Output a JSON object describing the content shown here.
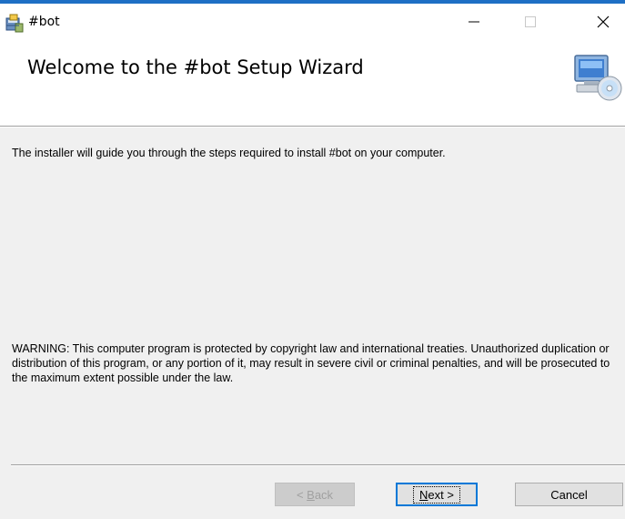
{
  "window": {
    "title": "#bot",
    "minimize_glyph": "—",
    "maximize_glyph": "☐",
    "close_glyph": "✕",
    "accent_color": "#1e6fc5"
  },
  "banner": {
    "title": "Welcome to the #bot Setup Wizard",
    "icon": "computer-cd-icon"
  },
  "body": {
    "intro": "The installer will guide you through the steps required to install #bot on your computer.",
    "warning": "WARNING: This computer program is protected by copyright law and international treaties. Unauthorized duplication or distribution of this program, or any portion of it, may result in severe civil or criminal penalties, and will be prosecuted to the maximum extent possible under the law."
  },
  "buttons": {
    "back": {
      "prefix": "< ",
      "mnemonic": "B",
      "rest": "ack",
      "disabled": true
    },
    "next": {
      "mnemonic": "N",
      "rest": "ext >"
    },
    "cancel": {
      "label": "Cancel"
    }
  }
}
